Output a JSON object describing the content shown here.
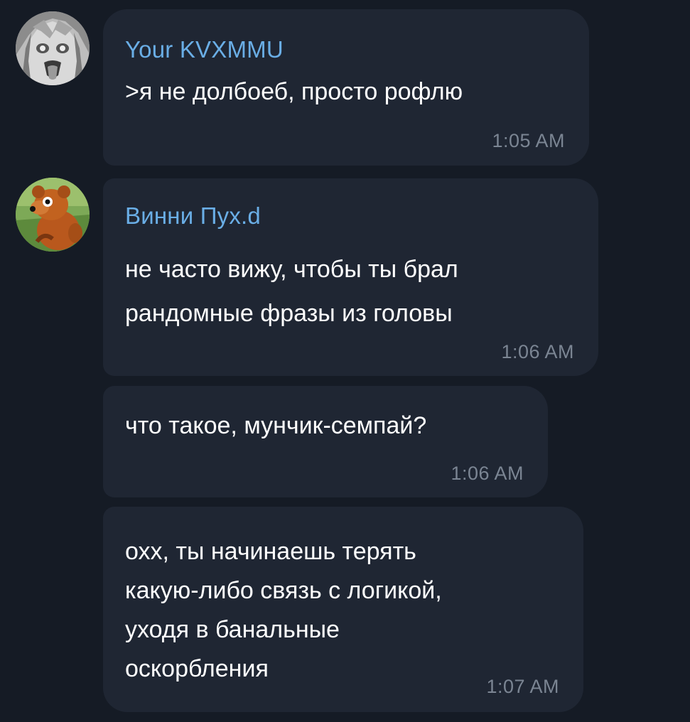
{
  "messages": [
    {
      "sender": "Your KVXMMU",
      "text_lines": [
        ">я не долбоеб, просто рофлю"
      ],
      "time": "1:05 AM",
      "avatar_icon": "anime-girl-avatar"
    },
    {
      "sender": "Винни Пух.d",
      "text_lines": [
        "не часто вижу, чтобы ты брал",
        "рандомные фразы из головы"
      ],
      "time": "1:06 AM",
      "avatar_icon": "winnie-pooh-avatar"
    },
    {
      "sender": "",
      "text_lines": [
        "что такое, мунчик-семпай?"
      ],
      "time": "1:06 AM"
    },
    {
      "sender": "",
      "text_lines": [
        "охх, ты начинаешь терять",
        "какую-либо связь с логикой,",
        "уходя в банальные",
        "оскорбления"
      ],
      "time": "1:07 AM"
    }
  ],
  "colors": {
    "background": "#151b25",
    "bubble": "#1f2633",
    "sender_name": "#6aaee6",
    "text": "#ffffff",
    "timestamp": "#7b8593"
  }
}
